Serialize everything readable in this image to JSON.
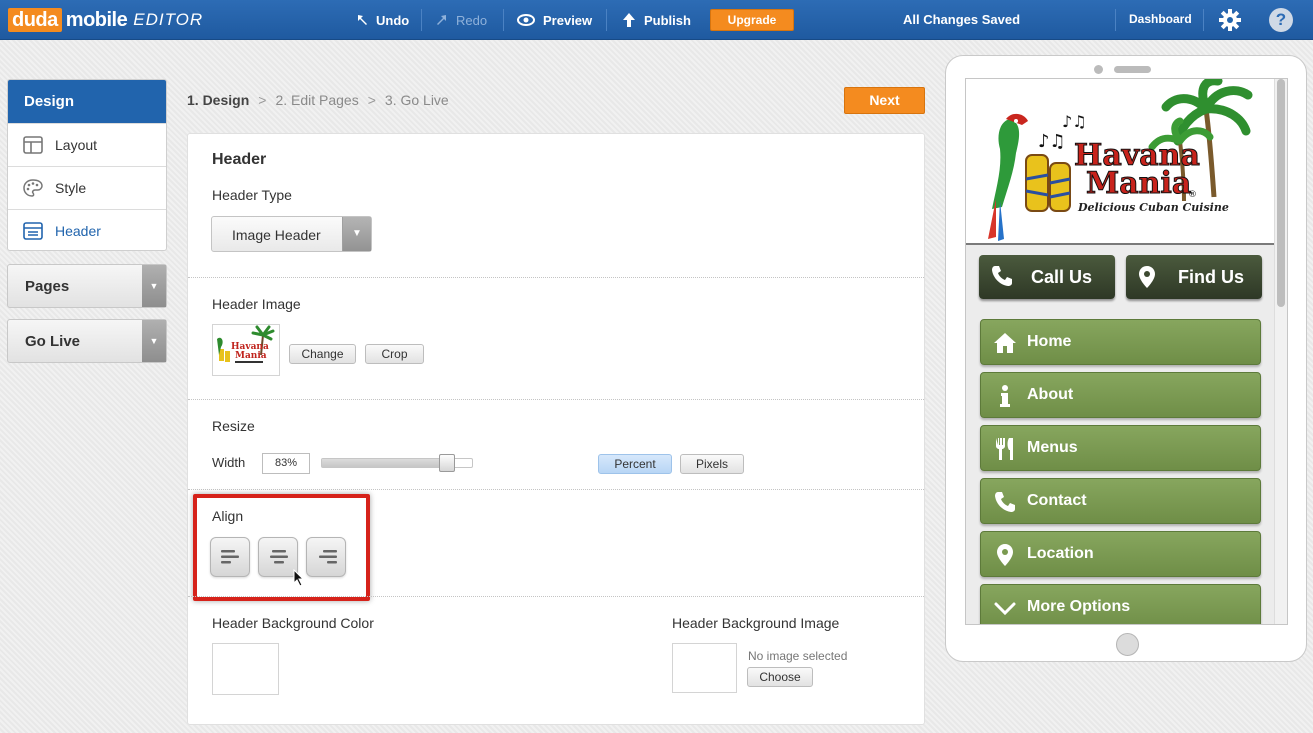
{
  "app": {
    "logo_duda": "duda",
    "logo_mobile": "mobile",
    "logo_editor": "EDITOR"
  },
  "toolbar": {
    "undo": "Undo",
    "redo": "Redo",
    "preview": "Preview",
    "publish": "Publish",
    "upgrade": "Upgrade",
    "status": "All Changes Saved",
    "dashboard": "Dashboard",
    "help": "?"
  },
  "sidebar": {
    "design": {
      "title": "Design",
      "items": [
        {
          "label": "Layout",
          "icon": "layout-icon"
        },
        {
          "label": "Style",
          "icon": "palette-icon"
        },
        {
          "label": "Header",
          "icon": "header-icon",
          "active": true
        }
      ]
    },
    "pages": "Pages",
    "go_live": "Go Live"
  },
  "steps": {
    "step1": "1. Design",
    "step2": "2. Edit Pages",
    "step3": "3. Go Live",
    "separator": ">",
    "next": "Next"
  },
  "panel": {
    "title": "Header",
    "header_type": {
      "label": "Header Type",
      "value": "Image Header"
    },
    "header_image": {
      "label": "Header Image",
      "change": "Change",
      "crop": "Crop"
    },
    "resize": {
      "label": "Resize",
      "width_label": "Width",
      "width_value": "83%",
      "slider_fraction": 0.83,
      "percent": "Percent",
      "pixels": "Pixels"
    },
    "align": {
      "label": "Align",
      "options": [
        "left",
        "center",
        "right"
      ]
    },
    "bg_color": {
      "label": "Header Background Color"
    },
    "bg_image": {
      "label": "Header Background Image",
      "empty": "No image selected",
      "choose": "Choose"
    }
  },
  "preview": {
    "logo_text": "Havana Mania",
    "logo_sub": "Delicious Cuban Cuisine",
    "call": "Call Us",
    "find": "Find Us",
    "menu": [
      {
        "label": "Home",
        "icon": "home-icon"
      },
      {
        "label": "About",
        "icon": "info-icon"
      },
      {
        "label": "Menus",
        "icon": "fork-knife-icon"
      },
      {
        "label": "Contact",
        "icon": "phone-icon"
      },
      {
        "label": "Location",
        "icon": "location-pin-icon"
      },
      {
        "label": "More Options",
        "icon": "chevron-down-icon"
      }
    ]
  },
  "colors": {
    "topbar": "#2164ad",
    "accent_orange": "#f48b1f",
    "menu_green": "#7a9a50",
    "highlight_red": "#d6221a"
  }
}
